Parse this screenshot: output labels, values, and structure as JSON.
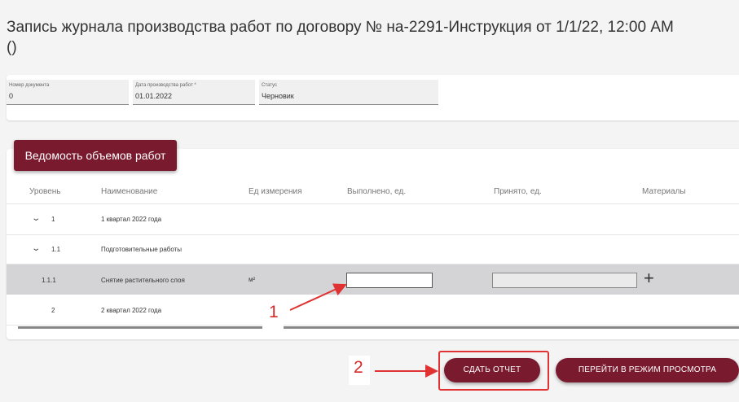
{
  "header": {
    "title": "Запись журнала производства работ по договору № на-2291-Инструкция от 1/1/22, 12:00 AM",
    "subtitle": "()"
  },
  "document": {
    "number": {
      "label": "Номер документа",
      "value": "0"
    },
    "date": {
      "label": "Дата производства работ *",
      "value": "01.01.2022"
    },
    "status": {
      "label": "Статус",
      "value": "Черновик"
    }
  },
  "section": {
    "tab_label": "Ведомость объемов работ"
  },
  "table": {
    "columns": [
      "Уровень",
      "Наименование",
      "Ед измерения",
      "Выполнено, ед.",
      "Принято, ед.",
      "Материалы"
    ],
    "rows": [
      {
        "level": "1",
        "name": "1 квартал 2022 года",
        "unit": ""
      },
      {
        "level": "1.1",
        "name": "Подготовительные работы",
        "unit": ""
      },
      {
        "level": "1.1.1",
        "name": "Снятие растительного слоя",
        "unit": "м²"
      },
      {
        "level": "2",
        "name": "2 квартал 2022 года",
        "unit": ""
      }
    ]
  },
  "annotations": {
    "one": "1",
    "two": "2",
    "color": "#e03232"
  },
  "buttons": {
    "submit": "СДАТЬ ОТЧЕТ",
    "view_mode": "ПЕРЕЙТИ В РЕЖИМ ПРОСМОТРА"
  },
  "icons": {
    "expand": "chevron-down-icon",
    "add": "plus-icon"
  },
  "colors": {
    "accent": "#7a1a2e",
    "row_highlight": "#d4d4d6"
  }
}
